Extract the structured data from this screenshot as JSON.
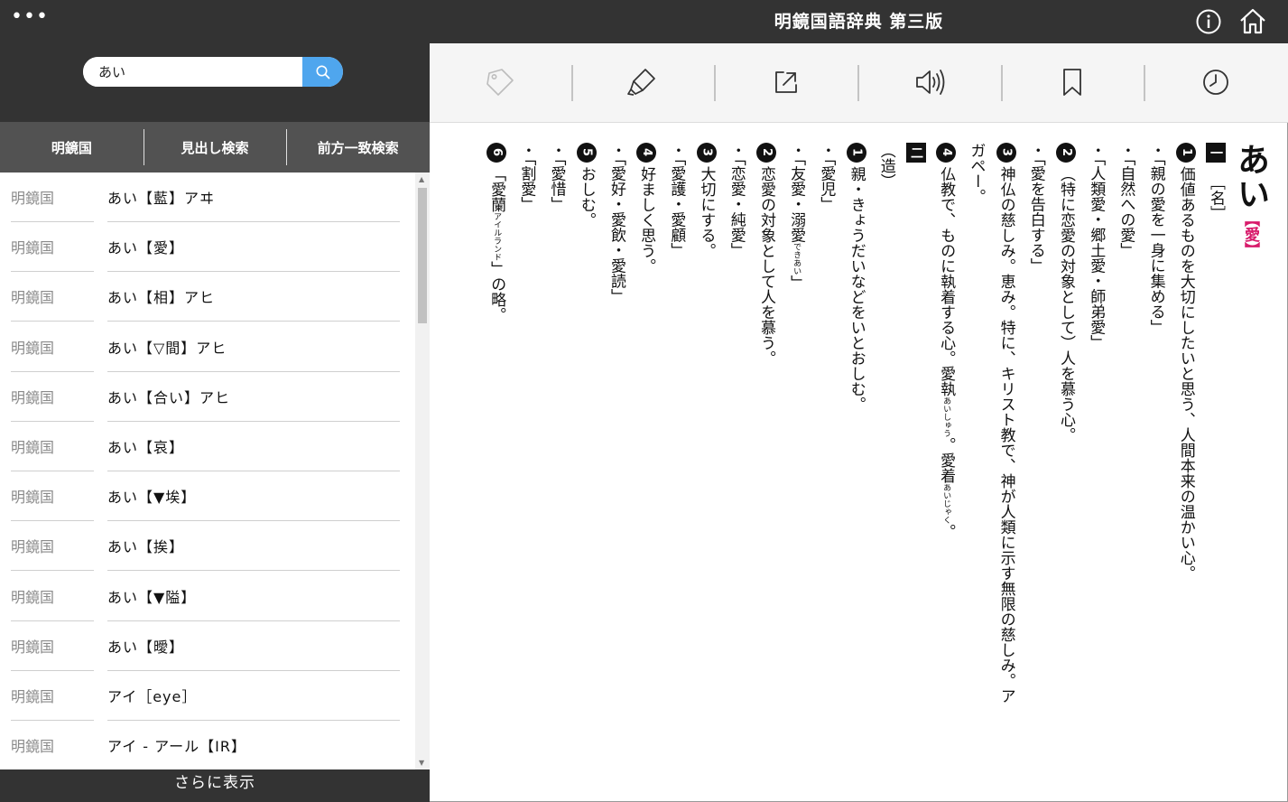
{
  "sidebar": {
    "menu_label": "•••",
    "search": {
      "value": "あい",
      "placeholder": ""
    },
    "tabs": [
      "明鏡国",
      "見出し検索",
      "前方一致検索"
    ],
    "results": [
      {
        "source": "明鏡国",
        "entry": "あい【藍】アヰ"
      },
      {
        "source": "明鏡国",
        "entry": "あい【愛】"
      },
      {
        "source": "明鏡国",
        "entry": "あい【相】アヒ"
      },
      {
        "source": "明鏡国",
        "entry": "あい【▽間】アヒ"
      },
      {
        "source": "明鏡国",
        "entry": "あい【合い】アヒ"
      },
      {
        "source": "明鏡国",
        "entry": "あい【哀】"
      },
      {
        "source": "明鏡国",
        "entry": "あい【▼埃】"
      },
      {
        "source": "明鏡国",
        "entry": "あい【挨】"
      },
      {
        "source": "明鏡国",
        "entry": "あい【▼隘】"
      },
      {
        "source": "明鏡国",
        "entry": "あい【曖】"
      },
      {
        "source": "明鏡国",
        "entry": "アイ［eye］"
      },
      {
        "source": "明鏡国",
        "entry": "アイ - アール【IR】"
      }
    ],
    "more_label": "さらに表示"
  },
  "header": {
    "title": "明鏡国語辞典 第三版",
    "info_icon": "info-icon",
    "home_icon": "home-icon"
  },
  "toolbar": {
    "icons": [
      "tag-icon",
      "highlighter-icon",
      "jump-icon",
      "speaker-icon",
      "bookmark-icon",
      "history-icon"
    ]
  },
  "entry": {
    "headword": "あい",
    "kanji": "【愛】",
    "pos": "［名］",
    "sec1": "一",
    "sec2": "二",
    "lines": [
      "価値あるものを大切にしたいと思う、人間本来の温かい心。",
      "・「親の愛を一身に集める」",
      "・「自然への愛」",
      "・「人類愛・郷土愛・師弟愛」",
      "（特に恋愛の対象として）人を慕う心。",
      "・「愛を告白する」",
      "神仏の慈しみ。恵み。特に、キリスト教で、神が人類に示す無限の慈しみ。ア",
      "ガペー。",
      "仏教で、ものに執着する心。愛執",
      "。愛着",
      "（造）",
      "親・きょうだいなどをいとおしむ。",
      "・「愛児」",
      "・「友愛・溺愛",
      "」",
      "恋愛の対象として人を慕う。",
      "・「恋愛・純愛」",
      "大切にする。",
      "・「愛護・愛顧」",
      "好ましく思う。",
      "・「愛好・愛飲・愛読」",
      "おしむ。",
      "・「愛惜」",
      "・「割愛」",
      "「愛蘭",
      "」の略。"
    ],
    "rubies": [
      "あいしゅう",
      "あいじゃく",
      "できあい",
      "アイルランド"
    ],
    "nums": [
      "1",
      "2",
      "3",
      "4",
      "1",
      "2",
      "3",
      "4",
      "5",
      "6"
    ]
  },
  "colors": {
    "dark": "#333333",
    "tabbar": "#525252",
    "accent": "#4fa6ee",
    "kanji": "#d81b6b"
  }
}
